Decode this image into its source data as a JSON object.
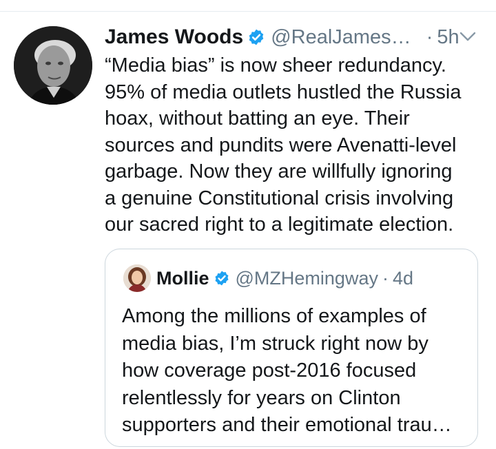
{
  "tweet": {
    "author_name": "James Woods",
    "handle": "@RealJames…",
    "separator": "·",
    "time": "5h",
    "text_lines": [
      "“Media bias” is now sheer redundancy.",
      "95% of media outlets hustled the Russia",
      "hoax, without batting an eye. Their",
      "sources and pundits were Avenatti-level",
      "garbage. Now they are willfully ignoring",
      "a genuine Constitutional crisis involving",
      "our sacred right to a legitimate election."
    ]
  },
  "quoted_tweet": {
    "author_name": "Mollie",
    "handle": "@MZHemingway",
    "separator": "·",
    "time": "4d",
    "text_lines": [
      "Among the millions of examples of",
      "media bias, I’m struck right now by",
      "how coverage post-2016 focused",
      "relentlessly for years on Clinton",
      "supporters and their emotional trau…"
    ]
  },
  "icons": {
    "verified": "verified-badge-icon",
    "menu": "chevron-down-icon"
  },
  "colors": {
    "text_primary": "#14171a",
    "text_secondary": "#657786",
    "verified_blue": "#1da1f2",
    "border": "#ccd6dd"
  }
}
